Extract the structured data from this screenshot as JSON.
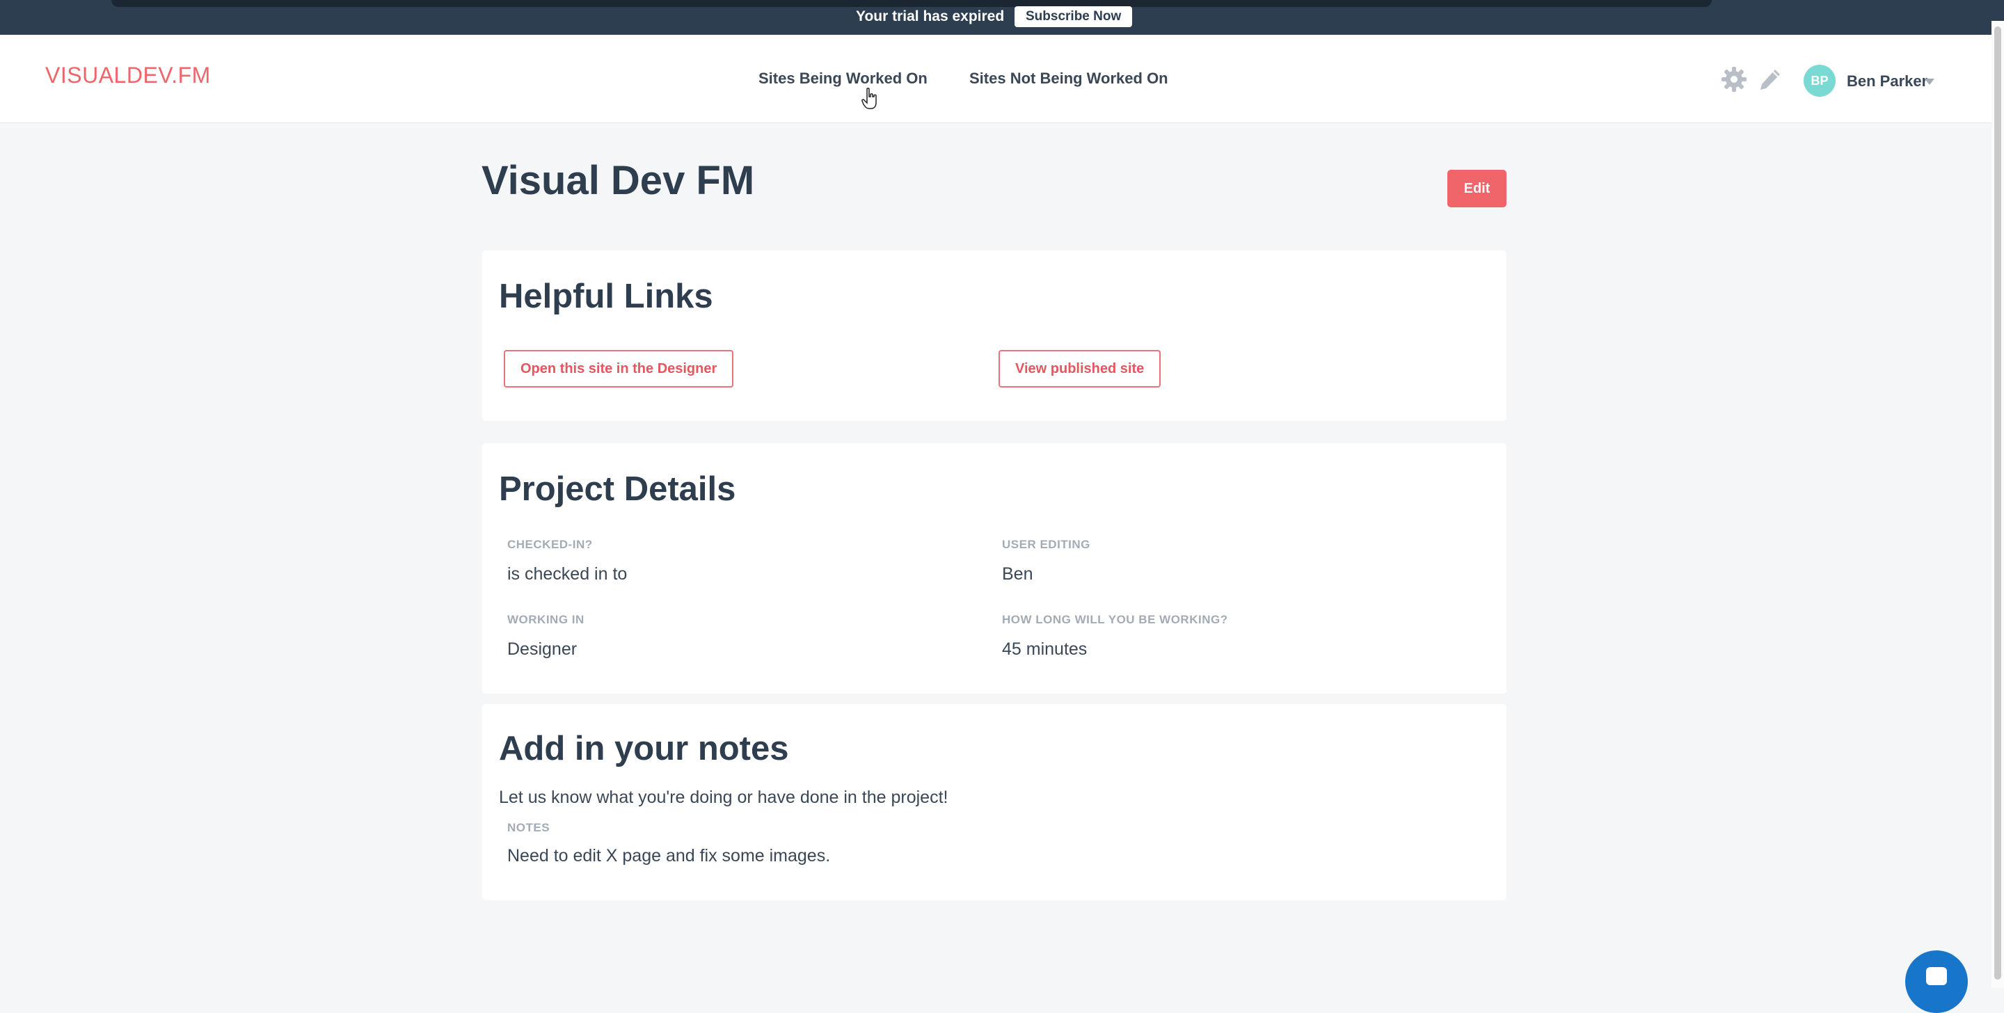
{
  "banner": {
    "trial_text": "Your trial has expired",
    "subscribe_label": "Subscribe Now"
  },
  "header": {
    "logo": "VISUALDEV.FM",
    "nav": [
      {
        "label": "Sites Being Worked On"
      },
      {
        "label": "Sites Not Being Worked On"
      }
    ],
    "user": {
      "initials": "BP",
      "name": "Ben Parker"
    },
    "icons": [
      "gear-icon",
      "pencil-icon",
      "chevron-down-icon"
    ]
  },
  "page": {
    "title": "Visual Dev FM",
    "edit_label": "Edit"
  },
  "helpful_links": {
    "heading": "Helpful Links",
    "designer_button": "Open this site in the Designer",
    "published_button": "View published site"
  },
  "project_details": {
    "heading": "Project Details",
    "fields": [
      {
        "label": "CHECKED-IN?",
        "value": "is checked in to"
      },
      {
        "label": "USER EDITING",
        "value": "Ben"
      },
      {
        "label": "WORKING IN",
        "value": "Designer"
      },
      {
        "label": "HOW LONG WILL YOU BE WORKING?",
        "value": "45 minutes"
      }
    ]
  },
  "notes": {
    "heading": "Add in your notes",
    "description": "Let us know what you're doing or have done in the project!",
    "label": "NOTES",
    "value": "Need to edit X page and fix some images."
  },
  "colors": {
    "brand": "#f0656a",
    "banner": "#2d3e50",
    "avatar": "#7ad9d2",
    "chat": "#1776c9"
  }
}
